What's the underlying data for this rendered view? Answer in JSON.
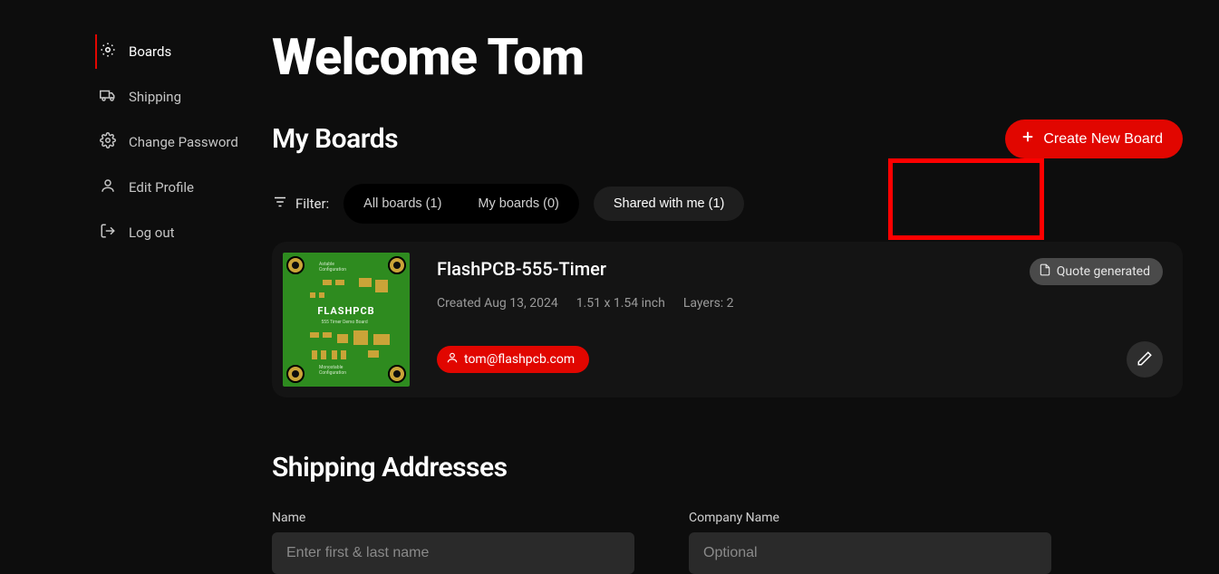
{
  "sidebar": {
    "items": [
      {
        "label": "Boards"
      },
      {
        "label": "Shipping"
      },
      {
        "label": "Change Password"
      },
      {
        "label": "Edit Profile"
      },
      {
        "label": "Log out"
      }
    ]
  },
  "header": {
    "welcome": "Welcome Tom"
  },
  "boards": {
    "section_title": "My Boards",
    "create_button": "Create New Board",
    "filter_label": "Filter:",
    "tabs": [
      {
        "label": "All boards (1)"
      },
      {
        "label": "My boards (0)"
      },
      {
        "label": "Shared with me (1)"
      }
    ],
    "card": {
      "name": "FlashPCB-555-Timer",
      "status": "Quote generated",
      "created": "Created Aug 13, 2024",
      "dimensions": "1.51 x 1.54 inch",
      "layers": "Layers: 2",
      "owner_email": "tom@flashpcb.com"
    }
  },
  "shipping": {
    "section_title": "Shipping Addresses",
    "name_label": "Name",
    "name_placeholder": "Enter first & last name",
    "company_label": "Company Name",
    "company_placeholder": "Optional"
  }
}
